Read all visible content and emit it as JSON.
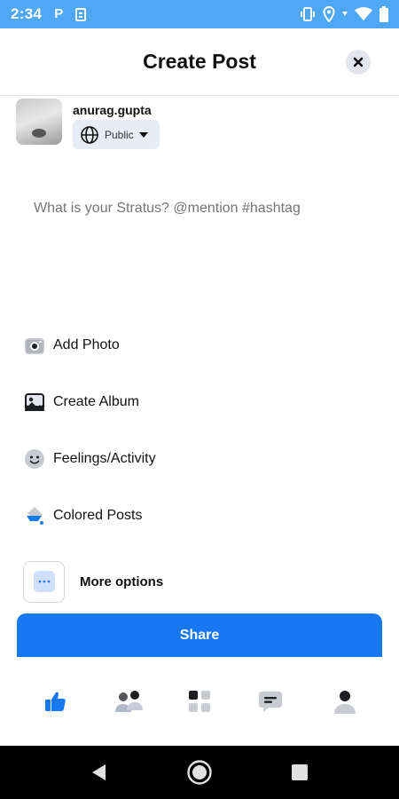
{
  "status_bar": {
    "time": "2:34",
    "left_icons": [
      "parking-icon",
      "note-icon"
    ],
    "right_icons": [
      "vibrate-icon",
      "location-icon",
      "wifi-icon",
      "battery-icon"
    ],
    "background": "#4ea8f5"
  },
  "header": {
    "title": "Create Post",
    "close_icon": "close-icon"
  },
  "user": {
    "name": "anurag.gupta",
    "privacy": "Public",
    "privacy_icon": "globe-icon"
  },
  "composer": {
    "placeholder": "What is your Stratus? @mention #hashtag"
  },
  "options": [
    {
      "label": "Add Photo",
      "icon": "camera-icon"
    },
    {
      "label": "Create Album",
      "icon": "image-icon"
    },
    {
      "label": "Feelings/Activity",
      "icon": "smiley-icon"
    },
    {
      "label": "Colored Posts",
      "icon": "paint-bucket-icon"
    }
  ],
  "more_options": {
    "label": "More options",
    "icon": "ellipsis-icon"
  },
  "share": {
    "label": "Share",
    "color": "#1877f2"
  },
  "tabbar": {
    "tabs": [
      {
        "icon": "thumbs-up-icon",
        "active": true
      },
      {
        "icon": "people-icon",
        "active": false
      },
      {
        "icon": "grid-icon",
        "active": false
      },
      {
        "icon": "chat-icon",
        "active": false
      },
      {
        "icon": "profile-icon",
        "active": false
      }
    ],
    "active_color": "#1877f2"
  },
  "nav": {
    "buttons": [
      "back-icon",
      "home-icon",
      "recents-icon"
    ]
  }
}
